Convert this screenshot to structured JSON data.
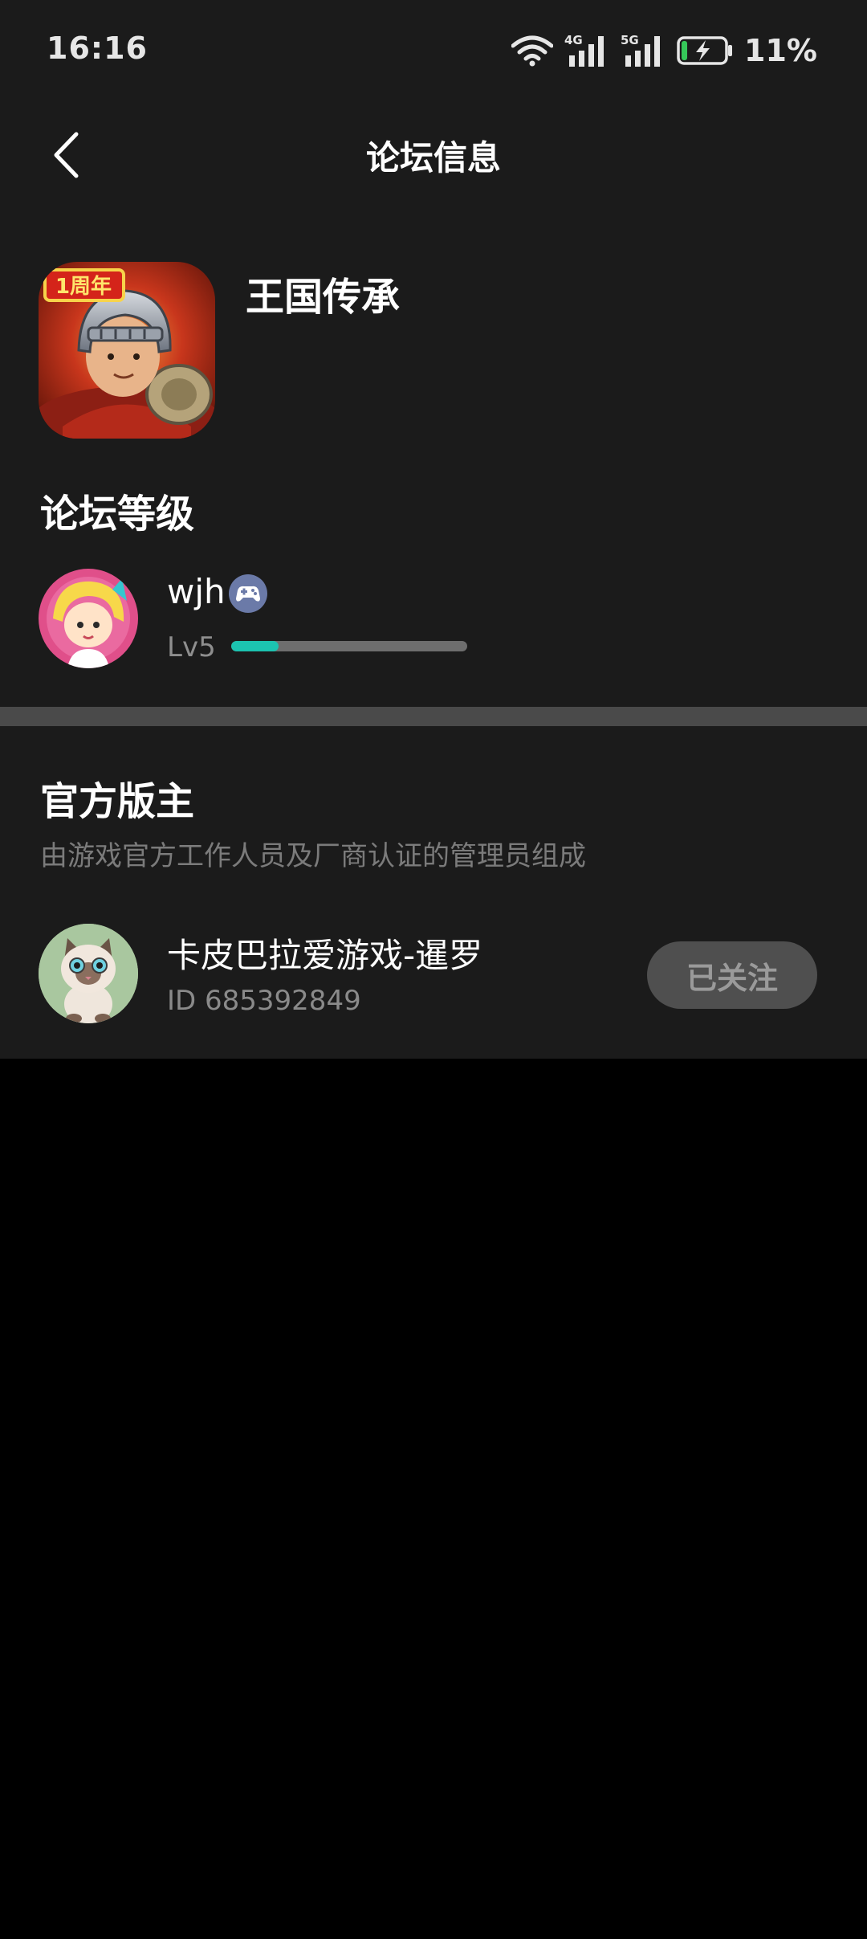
{
  "status_bar": {
    "time": "16:16",
    "network_4g": "4G",
    "network_5g": "5G",
    "battery_percent": "11%",
    "battery_level": 0.11
  },
  "header": {
    "title": "论坛信息"
  },
  "game": {
    "name": "王国传承",
    "badge_text": "1周年"
  },
  "level_section": {
    "title": "论坛等级",
    "username": "wjh",
    "level": "Lv5",
    "progress": 0.2
  },
  "moderator_section": {
    "title": "官方版主",
    "description": "由游戏官方工作人员及厂商认证的管理员组成",
    "moderator": {
      "name": "卡皮巴拉爱游戏-暹罗",
      "id_text": "ID 685392849",
      "follow_label": "已关注"
    }
  },
  "colors": {
    "background": "#1b1b1b",
    "accent": "#1cc3b0",
    "divider": "#4a4a4a"
  }
}
